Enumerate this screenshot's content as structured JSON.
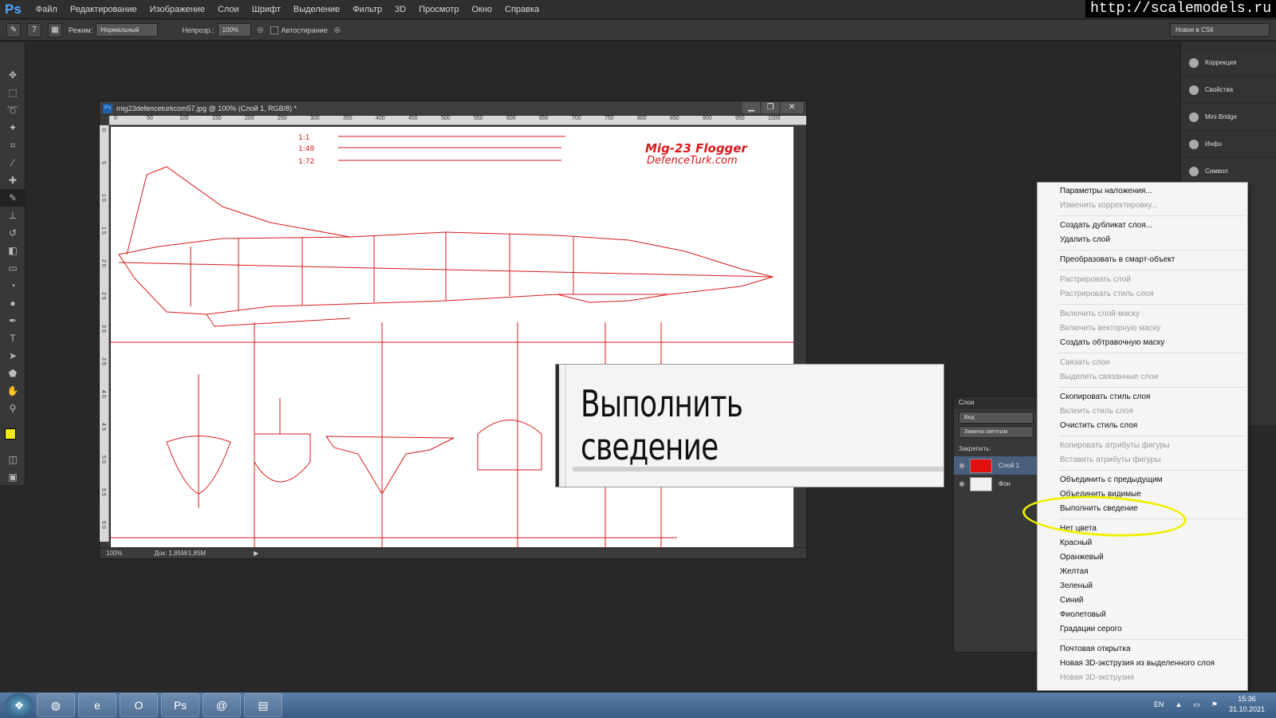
{
  "app": {
    "logo": "Ps",
    "menu": [
      "Файл",
      "Редактирование",
      "Изображение",
      "Слои",
      "Шрифт",
      "Выделение",
      "Фильтр",
      "3D",
      "Просмотр",
      "Окно",
      "Справка"
    ],
    "watermark": "http://scalemodels.ru"
  },
  "options": {
    "brush_size": "7",
    "mode_label": "Режим:",
    "mode_value": "Нормальный",
    "opacity_label": "Непрозр.:",
    "opacity_value": "100%",
    "auto_erase_label": "Автостирание",
    "workspace": "Новое в CS6"
  },
  "document": {
    "title": "mig23defenceturkcom57.jpg @ 100% (Слой 1, RGB/8) *",
    "ruler_h": [
      "0",
      "50",
      "100",
      "150",
      "200",
      "250",
      "300",
      "350",
      "400",
      "450",
      "500",
      "550",
      "600",
      "650",
      "700",
      "750",
      "800",
      "850",
      "900",
      "950",
      "1000"
    ],
    "ruler_v": [
      "0",
      "5",
      "1 0",
      "1 5",
      "2 0",
      "2 5",
      "3 0",
      "3 5",
      "4 0",
      "4 5",
      "5 0",
      "5 5",
      "6 0"
    ],
    "zoom": "100%",
    "doc_size": "Док: 1,85M/1,85M",
    "drawing": {
      "title": "Mig-23 Flogger",
      "subtitle": "DefenceTurk.com",
      "scales": [
        "1:1",
        "1:48",
        "1:72"
      ],
      "accent": "#d81a1a"
    }
  },
  "callout": {
    "text": "Выполнить сведение"
  },
  "right_dock": {
    "items": [
      "Коррекция",
      "Свойства",
      "Mini Bridge",
      "Инфо",
      "Символ"
    ]
  },
  "layers": {
    "tab": "Слои",
    "filter": "Вид",
    "blend": "Замена светлым",
    "lock_label": "Закрепить:",
    "items": [
      {
        "name": "Слой 1",
        "color": "#e01010"
      },
      {
        "name": "Фон",
        "color": "#f0f0f0"
      }
    ]
  },
  "context_menu": {
    "groups": [
      [
        {
          "label": "Параметры наложения...",
          "enabled": true
        },
        {
          "label": "Изменить корректировку...",
          "enabled": false
        }
      ],
      [
        {
          "label": "Создать дубликат слоя...",
          "enabled": true
        },
        {
          "label": "Удалить слой",
          "enabled": true
        }
      ],
      [
        {
          "label": "Преобразовать в смарт-объект",
          "enabled": true
        }
      ],
      [
        {
          "label": "Растрировать слой",
          "enabled": false
        },
        {
          "label": "Растрировать стиль слоя",
          "enabled": false
        }
      ],
      [
        {
          "label": "Включить слой-маску",
          "enabled": false
        },
        {
          "label": "Включить векторную маску",
          "enabled": false
        },
        {
          "label": "Создать обтравочную маску",
          "enabled": true
        }
      ],
      [
        {
          "label": "Связать слои",
          "enabled": false
        },
        {
          "label": "Выделить связанные слои",
          "enabled": false
        }
      ],
      [
        {
          "label": "Скопировать стиль слоя",
          "enabled": true
        },
        {
          "label": "Вклеить стиль слоя",
          "enabled": false
        },
        {
          "label": "Очистить стиль слоя",
          "enabled": true
        }
      ],
      [
        {
          "label": "Копировать атрибуты фигуры",
          "enabled": false
        },
        {
          "label": "Вставить атрибуты фигуры",
          "enabled": false
        }
      ],
      [
        {
          "label": "Объединить с предыдущим",
          "enabled": true
        },
        {
          "label": "Объединить видимые",
          "enabled": true
        },
        {
          "label": "Выполнить сведение",
          "enabled": true
        }
      ],
      [
        {
          "label": "Нет цвета",
          "enabled": true
        },
        {
          "label": "Красный",
          "enabled": true
        },
        {
          "label": "Оранжевый",
          "enabled": true
        },
        {
          "label": "Желтая",
          "enabled": true
        },
        {
          "label": "Зеленый",
          "enabled": true
        },
        {
          "label": "Синий",
          "enabled": true
        },
        {
          "label": "Фиолетовый",
          "enabled": true
        },
        {
          "label": "Градации серого",
          "enabled": true
        }
      ],
      [
        {
          "label": "Почтовая открытка",
          "enabled": true
        },
        {
          "label": "Новая 3D-экструзия из выделенного слоя",
          "enabled": true
        },
        {
          "label": "Новая 3D-экструзия",
          "enabled": false
        }
      ]
    ]
  },
  "taskbar": {
    "apps": [
      "Chrome",
      "IE",
      "Opera",
      "Ps",
      "@",
      "Folder"
    ],
    "lang": "EN",
    "time": "15:36",
    "date": "31.10.2021"
  }
}
